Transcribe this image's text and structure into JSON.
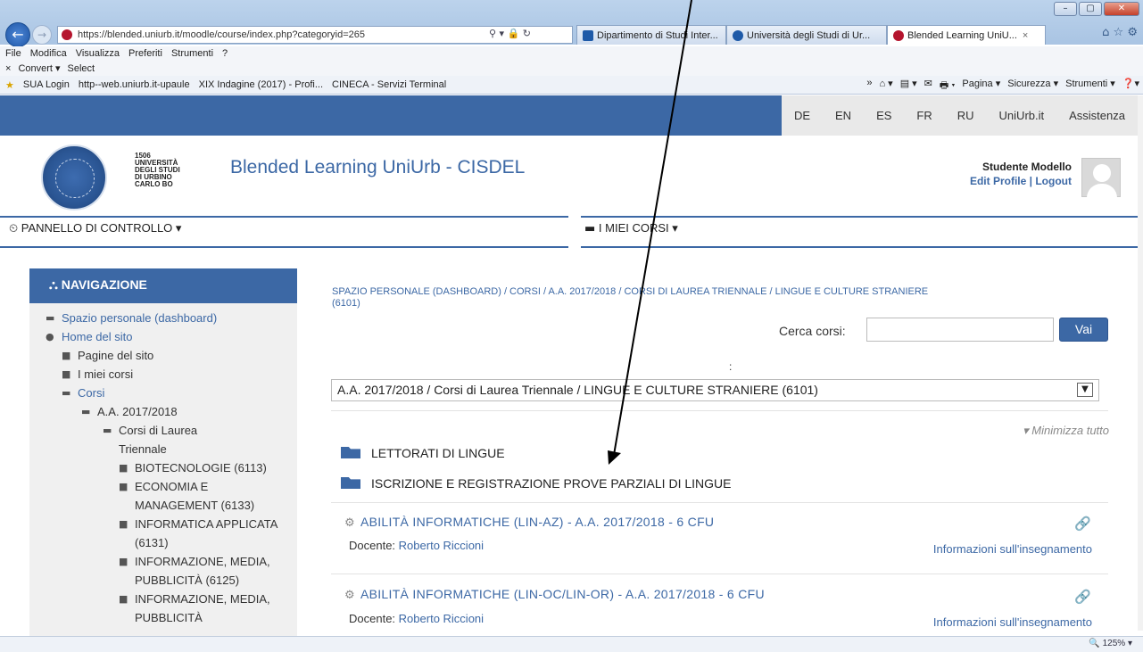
{
  "browser": {
    "window_buttons": [
      "–",
      "▢",
      "✕"
    ],
    "address": "https://blended.uniurb.it/moodle/course/index.php?categoryid=265",
    "address_icons": "⚲ ▾ 🔒 ↻",
    "tabs": [
      {
        "label": "Dipartimento di Studi Inter...",
        "color": "#1e5aa8"
      },
      {
        "label": "Università degli Studi di Ur...",
        "color": "#1e5aa8"
      },
      {
        "label": "Blended Learning UniU...",
        "color": "#b5152e",
        "close": "×"
      }
    ],
    "right_icons": "⌂ ☆ ⚙",
    "menu": [
      "File",
      "Modifica",
      "Visualizza",
      "Preferiti",
      "Strumenti",
      "?"
    ],
    "toolbar2": [
      "×",
      "Convert ▾",
      "Select"
    ],
    "favorites": [
      "SUA Login",
      "http--web.uniurb.it-upaule",
      "XIX Indagine (2017) - Profi...",
      "CINECA - Servizi Terminal"
    ],
    "commands": [
      "»",
      "⌂ ▾",
      "▤ ▾",
      "✉",
      "🖶 ▾",
      "Pagina ▾",
      "Sicurezza ▾",
      "Strumenti ▾",
      "❓▾"
    ],
    "zoom": "🔍 125% ▾"
  },
  "site": {
    "languages": [
      "DE",
      "EN",
      "ES",
      "FR",
      "RU",
      "UniUrb.it",
      "Assistenza"
    ],
    "university_lines": [
      "1506",
      "UNIVERSITÀ",
      "DEGLI STUDI",
      "DI URBINO",
      "CARLO BO"
    ],
    "title": "Blended Learning UniUrb - CISDEL",
    "user_name": "Studente Modello",
    "edit_profile": "Edit Profile",
    "logout": "Logout",
    "user_sep": "|",
    "menu_dashboard": "PANNELLO DI CONTROLLO ▾",
    "menu_courses": "I MIEI CORSI ▾"
  },
  "navigation": {
    "title": "NAVIGAZIONE",
    "items": [
      {
        "label": "Spazio personale (dashboard)",
        "icon": "▬"
      },
      {
        "label": "Home del sito",
        "icon": "●"
      },
      {
        "label": "Pagine del sito",
        "icon": "■"
      },
      {
        "label": "I miei corsi",
        "icon": "■"
      },
      {
        "label": "Corsi",
        "icon": "▬"
      },
      {
        "label": "A.A. 2017/2018",
        "icon": "▬"
      },
      {
        "label": "Corsi di Laurea Triennale",
        "icon": "▬"
      },
      {
        "label": "BIOTECNOLOGIE (6113)",
        "icon": "■"
      },
      {
        "label": "ECONOMIA E MANAGEMENT (6133)",
        "icon": "■"
      },
      {
        "label": "INFORMATICA APPLICATA (6131)",
        "icon": "■"
      },
      {
        "label": "INFORMAZIONE, MEDIA, PUBBLICITÀ (6125)",
        "icon": "■"
      },
      {
        "label": "INFORMAZIONE, MEDIA, PUBBLICITÀ",
        "icon": "■"
      }
    ]
  },
  "main": {
    "breadcrumb": "SPAZIO PERSONALE (DASHBOARD)  /  CORSI  /  A.A. 2017/2018  /  CORSI DI LAUREA TRIENNALE  /  LINGUE E CULTURE STRANIERE (6101)",
    "search_label": "Cerca corsi:",
    "search_value": "",
    "search_button": "Vai",
    "colon": ":",
    "category_select": "A.A. 2017/2018 / Corsi di Laurea Triennale / LINGUE E CULTURE STRANIERE (6101)",
    "select_arrow": "▼",
    "collapse_all": "▾ Minimizza tutto",
    "categories": [
      "LETTORATI DI LINGUE",
      "ISCRIZIONE E REGISTRAZIONE PROVE PARZIALI DI LINGUE"
    ],
    "courses": [
      {
        "title": "ABILITÀ INFORMATICHE (LIN-AZ) - A.A. 2017/2018 - 6 CFU",
        "teacher_label": "Docente:",
        "teacher": "Roberto Riccioni",
        "info": "Informazioni sull'insegnamento",
        "icon": "⚙",
        "enrol_icon": "🔗"
      },
      {
        "title": "ABILITÀ INFORMATICHE (LIN-OC/LIN-OR) - A.A. 2017/2018 - 6 CFU",
        "teacher_label": "Docente:",
        "teacher": "Roberto Riccioni",
        "info": "Informazioni sull'insegnamento",
        "icon": "⚙",
        "enrol_icon": "🔗"
      }
    ]
  },
  "colors": {
    "brand_blue": "#3c68a5",
    "annotation": "#000000"
  }
}
